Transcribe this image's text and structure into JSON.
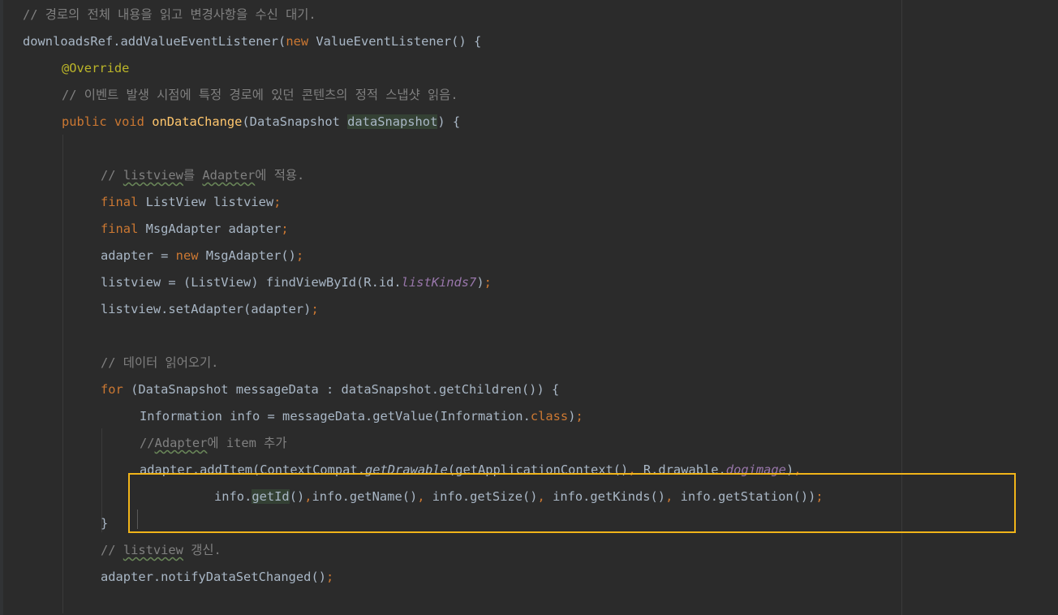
{
  "editor": {
    "lines": [
      {
        "parts": [
          {
            "t": "// 경로의 전체 내용을 읽고 변경사항을 수신 대기.",
            "c": "cmt"
          }
        ]
      },
      {
        "parts": [
          {
            "t": "downloadsRef.addValueEventListener(",
            "c": ""
          },
          {
            "t": "new",
            "c": "kw"
          },
          {
            "t": " ValueEventListener() {",
            "c": ""
          }
        ]
      },
      {
        "parts": [
          {
            "t": "@Override",
            "c": "ann"
          }
        ]
      },
      {
        "parts": [
          {
            "t": "// 이벤트 발생 시점에 특정 경로에 있던 콘텐츠의 정적 스냅샷 읽음.",
            "c": "cmt"
          }
        ]
      },
      {
        "parts": [
          {
            "t": "public void ",
            "c": "kw"
          },
          {
            "t": "onDataChange",
            "c": "fn"
          },
          {
            "t": "(DataSnapshot ",
            "c": ""
          },
          {
            "t": "dataSnapshot",
            "c": "hl"
          },
          {
            "t": ") {",
            "c": ""
          }
        ]
      },
      {
        "parts": []
      },
      {
        "parts": [
          {
            "t": "// ",
            "c": "cmt"
          },
          {
            "t": "listview",
            "c": "cmt typo"
          },
          {
            "t": "를 ",
            "c": "cmt"
          },
          {
            "t": "Adapter",
            "c": "cmt typo"
          },
          {
            "t": "에 적용.",
            "c": "cmt"
          }
        ]
      },
      {
        "parts": [
          {
            "t": "final ",
            "c": "kw"
          },
          {
            "t": "ListView listview",
            "c": ""
          },
          {
            "t": ";",
            "c": "kw"
          }
        ]
      },
      {
        "parts": [
          {
            "t": "final ",
            "c": "kw"
          },
          {
            "t": "MsgAdapter adapter",
            "c": ""
          },
          {
            "t": ";",
            "c": "kw"
          }
        ]
      },
      {
        "parts": [
          {
            "t": "adapter = ",
            "c": ""
          },
          {
            "t": "new ",
            "c": "kw"
          },
          {
            "t": "MsgAdapter()",
            "c": ""
          },
          {
            "t": ";",
            "c": "kw"
          }
        ]
      },
      {
        "parts": [
          {
            "t": "listview = (ListView) findViewById(R.id.",
            "c": ""
          },
          {
            "t": "listKinds7",
            "c": "fld"
          },
          {
            "t": ")",
            "c": ""
          },
          {
            "t": ";",
            "c": "kw"
          }
        ]
      },
      {
        "parts": [
          {
            "t": "listview.setAdapter(adapter)",
            "c": ""
          },
          {
            "t": ";",
            "c": "kw"
          }
        ]
      },
      {
        "parts": []
      },
      {
        "parts": [
          {
            "t": "// 데이터 읽어오기.",
            "c": "cmt"
          }
        ]
      },
      {
        "parts": [
          {
            "t": "for ",
            "c": "kw"
          },
          {
            "t": "(DataSnapshot messageData : dataSnapshot.getChildren()) {",
            "c": ""
          }
        ]
      },
      {
        "parts": [
          {
            "t": "Information info = messageData.getValue(Information.",
            "c": ""
          },
          {
            "t": "class",
            "c": "kw"
          },
          {
            "t": ")",
            "c": ""
          },
          {
            "t": ";",
            "c": "kw"
          }
        ]
      },
      {
        "parts": [
          {
            "t": "//",
            "c": "cmt"
          },
          {
            "t": "Adapter",
            "c": "cmt typo"
          },
          {
            "t": "에 item 추가",
            "c": "cmt"
          }
        ]
      },
      {
        "parts": [
          {
            "t": "adapter.addItem(ContextCompat.",
            "c": ""
          },
          {
            "t": "getDrawable",
            "c": "stat"
          },
          {
            "t": "(getApplicationContext()",
            "c": ""
          },
          {
            "t": ", ",
            "c": "kw"
          },
          {
            "t": "R.drawable.",
            "c": ""
          },
          {
            "t": "dogimage",
            "c": "fld"
          },
          {
            "t": ")",
            "c": ""
          },
          {
            "t": ",",
            "c": "kw"
          }
        ]
      },
      {
        "parts": [
          {
            "t": "info.",
            "c": ""
          },
          {
            "t": "getId",
            "c": "hl"
          },
          {
            "t": "()",
            "c": ""
          },
          {
            "t": ",",
            "c": "kw"
          },
          {
            "t": "info.getName()",
            "c": ""
          },
          {
            "t": ", ",
            "c": "kw"
          },
          {
            "t": "info.getSize()",
            "c": ""
          },
          {
            "t": ", ",
            "c": "kw"
          },
          {
            "t": "info.getKinds()",
            "c": ""
          },
          {
            "t": ", ",
            "c": "kw"
          },
          {
            "t": "info.getStation())",
            "c": ""
          },
          {
            "t": ";",
            "c": "kw"
          }
        ]
      },
      {
        "parts": [
          {
            "t": "}",
            "c": ""
          }
        ]
      },
      {
        "parts": [
          {
            "t": "// ",
            "c": "cmt"
          },
          {
            "t": "listview",
            "c": "cmt typo"
          },
          {
            "t": " 갱신.",
            "c": "cmt"
          }
        ]
      },
      {
        "parts": [
          {
            "t": "adapter.notifyDataSetChanged()",
            "c": ""
          },
          {
            "t": ";",
            "c": "kw"
          }
        ]
      }
    ],
    "colors": {
      "background": "#2b2b2b",
      "text": "#a9b7c6",
      "keyword": "#cc7832",
      "comment": "#808080",
      "annotation": "#bbb529",
      "method_declaration": "#ffc66d",
      "field": "#9876aa",
      "highlight_box": "#f0b419"
    }
  }
}
